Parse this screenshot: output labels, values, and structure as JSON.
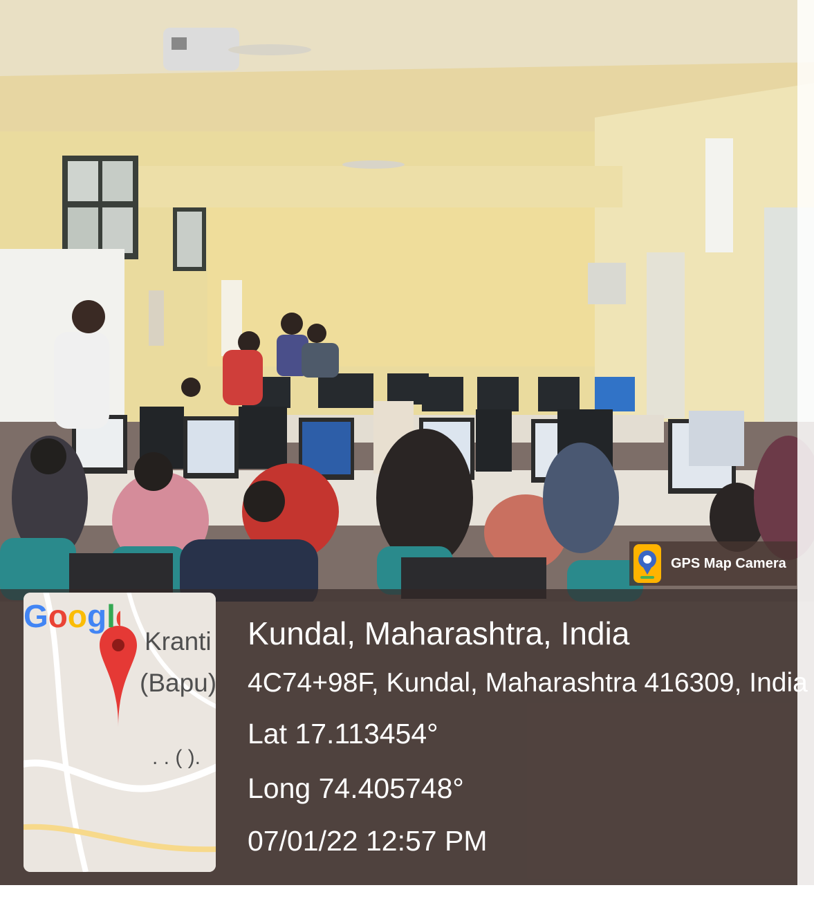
{
  "watermark": {
    "app_name": "GPS Map Camera",
    "icon": "gps-map-camera-app-icon"
  },
  "map_thumbnail": {
    "place_label_line1": "Kranti",
    "place_label_line2": "(Bapu)",
    "dots_label": ". . (   ).",
    "logo_text": "Google",
    "logo_colors": [
      "#4285F4",
      "#EA4335",
      "#FBBC05",
      "#4285F4",
      "#34A853",
      "#EA4335"
    ],
    "pin_color": "#E53935"
  },
  "location": {
    "title": "Kundal, Maharashtra, India",
    "address": "4C74+98F, Kundal, Maharashtra 416309, India",
    "latitude": "Lat 17.113454°",
    "longitude": "Long 74.405748°",
    "timestamp": "07/01/22 12:57 PM"
  },
  "scene": {
    "description_icon": "computer-lab-photo"
  }
}
